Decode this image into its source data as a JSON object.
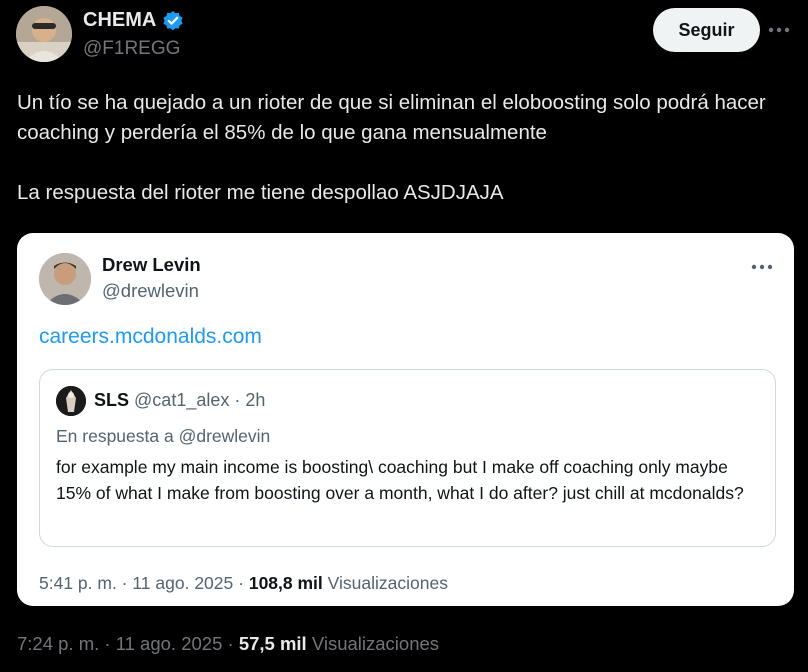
{
  "author": {
    "name": "CHEMA",
    "handle": "@F1REGG"
  },
  "follow_label": "Seguir",
  "tweet": {
    "line1": "Un tío se ha quejado a un rioter de que si eliminan el eloboosting solo podrá hacer coaching y perdería el 85% de lo que gana mensualmente",
    "line2": "La respuesta del rioter me tiene despollao ASJDJAJA"
  },
  "quoted_tweet": {
    "name": "Drew Levin",
    "handle": "@drewlevin",
    "link": "careers.mcdonalds.com",
    "reply": {
      "name": "SLS",
      "handle": "@cat1_alex",
      "separator": "·",
      "time": "2h",
      "in_reply_to": "En respuesta a @drewlevin",
      "text": "for example my main income is boosting\\ coaching but I make off coaching only maybe 15% of what I make from boosting over a month, what I do after? just chill at mcdonalds?"
    },
    "timestamp": "5:41 p. m. · 11 ago. 2025",
    "separator": "·",
    "views_count": "108,8 mil",
    "views_label": "Visualizaciones"
  },
  "meta": {
    "timestamp": "7:24 p. m. · 11 ago. 2025",
    "separator": "·",
    "views_count": "57,5 mil",
    "views_label": "Visualizaciones"
  },
  "colors": {
    "background": "#000000",
    "accent": "#1d9bf0",
    "verified": "#1d9bf0",
    "follow_bg": "#eff3f4"
  },
  "icons": {
    "verified": "verified-badge-icon",
    "more": "more-horizontal-icon"
  }
}
